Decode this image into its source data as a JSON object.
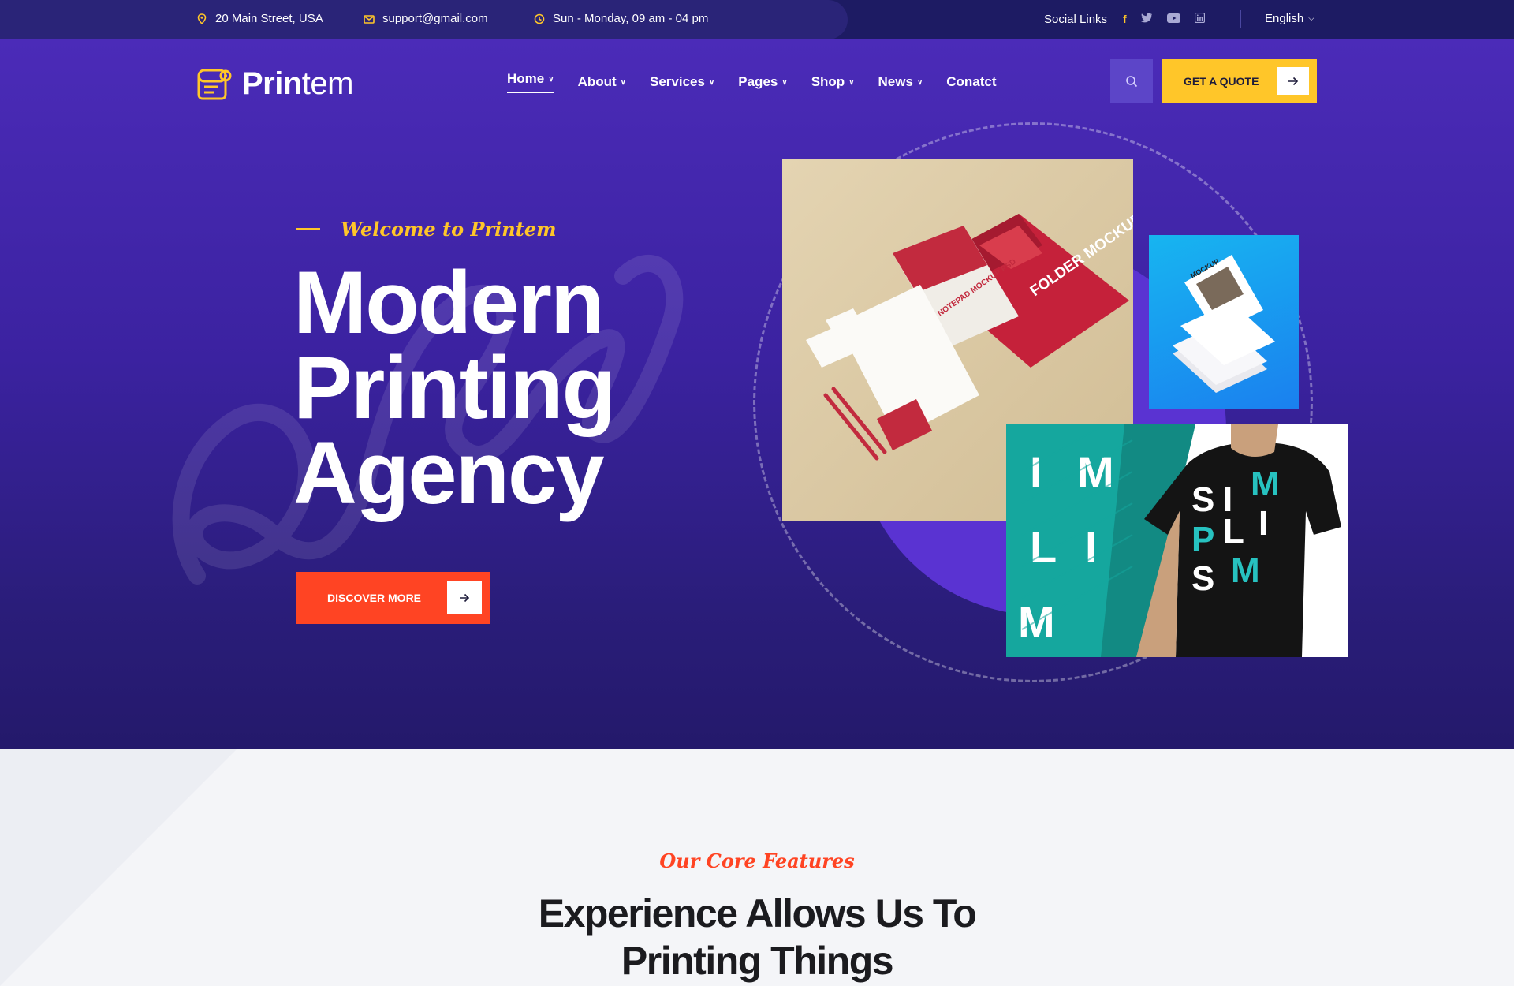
{
  "topbar": {
    "address": "20 Main Street, USA",
    "email": "support@gmail.com",
    "hours": "Sun - Monday, 09 am - 04 pm",
    "social_label": "Social Links",
    "social_icons": [
      "facebook-icon",
      "twitter-icon",
      "youtube-icon",
      "linkedin-icon"
    ],
    "language": "English"
  },
  "header": {
    "logo_bold": "Prin",
    "logo_light": "tem",
    "nav": [
      {
        "label": "Home",
        "active": true,
        "dropdown": true
      },
      {
        "label": "About",
        "dropdown": true
      },
      {
        "label": "Services",
        "dropdown": true
      },
      {
        "label": "Pages",
        "dropdown": true
      },
      {
        "label": "Shop",
        "dropdown": true
      },
      {
        "label": "News",
        "dropdown": true
      },
      {
        "label": "Conatct",
        "dropdown": false
      }
    ],
    "quote_label": "GET A QUOTE"
  },
  "hero": {
    "kicker": "Welcome to Printem",
    "title_lines": [
      "Modern",
      "Printing",
      "Agency"
    ],
    "cta_label": "DISCOVER MORE",
    "stationery_labels": [
      "NOTEPAD MOCKUP PSD",
      "FOLDER MOCKUP PSD"
    ],
    "flyer_label": "MOCKUP",
    "shirt_left": [
      "I",
      "M",
      "L",
      "I",
      "M"
    ],
    "shirt_right": [
      "S",
      "I",
      "M",
      "P",
      "L",
      "I",
      "S",
      "M"
    ]
  },
  "features": {
    "kicker": "Our Core Features",
    "title_line1": "Experience Allows Us To",
    "title_line2": "Printing Things"
  },
  "colors": {
    "accent_yellow": "#ffc629",
    "accent_red": "#ff4423",
    "hero_purple": "#4b2bb8",
    "topbar_navy": "#1d1b63"
  }
}
